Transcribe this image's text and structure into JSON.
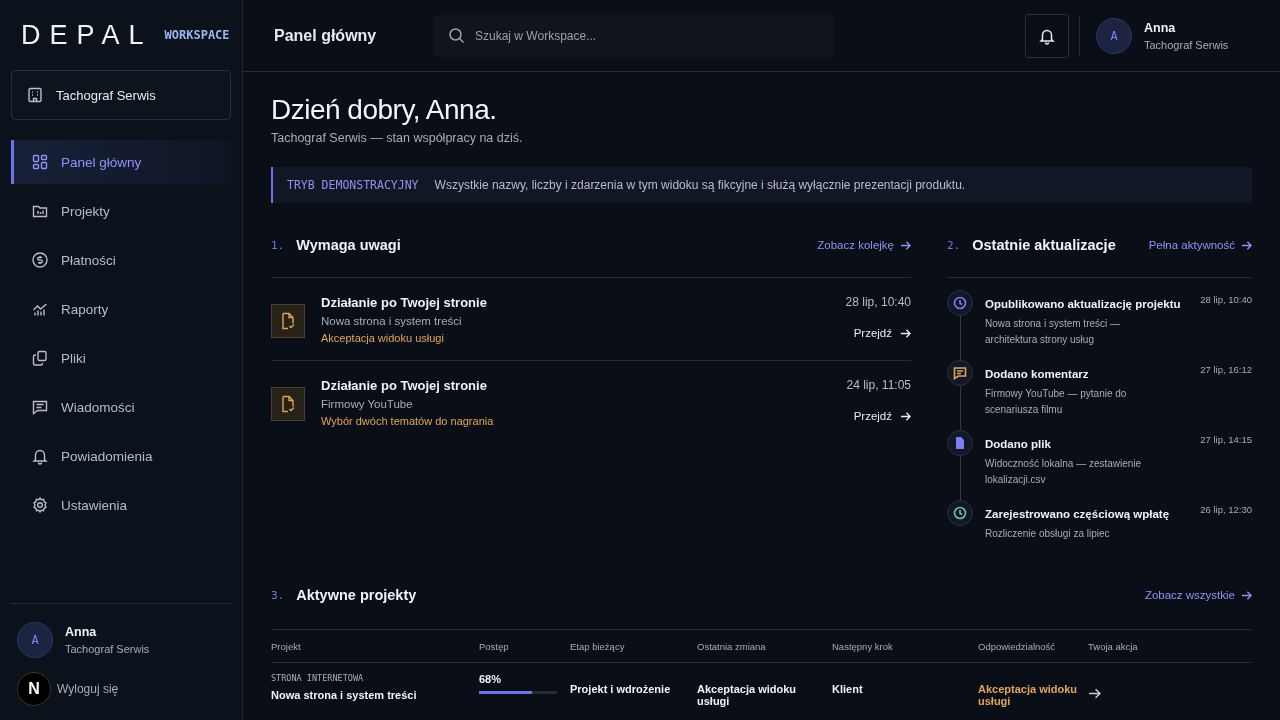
{
  "brand": {
    "logo": "DEPAL",
    "tag": "WORKSPACE"
  },
  "sidebar": {
    "workspace": "Tachograf Serwis",
    "items": [
      {
        "label": "Panel główny",
        "kind": "grid",
        "selected": true
      },
      {
        "label": "Projekty",
        "kind": "folder",
        "selected": false
      },
      {
        "label": "Płatności",
        "kind": "dollar",
        "selected": false
      },
      {
        "label": "Raporty",
        "kind": "chart",
        "selected": false
      },
      {
        "label": "Pliki",
        "kind": "files",
        "selected": false
      },
      {
        "label": "Wiadomości",
        "kind": "message",
        "selected": false
      },
      {
        "label": "Powiadomienia",
        "kind": "bell",
        "selected": false
      },
      {
        "label": "Ustawienia",
        "kind": "gear",
        "selected": false
      }
    ],
    "user": {
      "initial": "A",
      "name": "Anna",
      "company": "Tachograf Serwis"
    },
    "dev_badge": "N",
    "logout": "Wyloguj się"
  },
  "header": {
    "title": "Panel główny",
    "search_placeholder": "Szukaj w Workspace...",
    "user": {
      "initial": "A",
      "name": "Anna",
      "company": "Tachograf Serwis"
    }
  },
  "greeting": {
    "title": "Dzień dobry, Anna.",
    "subtitle": "Tachograf Serwis — stan współpracy na dziś."
  },
  "demo_banner": {
    "label": "TRYB DEMONSTRACYJNY",
    "text": "Wszystkie nazwy, liczby i zdarzenia w tym widoku są fikcyjne i służą wyłącznie prezentacji produktu."
  },
  "attention": {
    "number": "1.",
    "title": "Wymaga uwagi",
    "link": "Zobacz kolejkę",
    "items": [
      {
        "title": "Działanie po Twojej stronie",
        "project": "Nowa strona i system treści",
        "task": "Akceptacja widoku usługi",
        "time": "28 lip, 10:40",
        "action": "Przejdź"
      },
      {
        "title": "Działanie po Twojej stronie",
        "project": "Firmowy YouTube",
        "task": "Wybór dwóch tematów do nagrania",
        "time": "24 lip, 11:05",
        "action": "Przejdź"
      }
    ]
  },
  "updates": {
    "number": "2.",
    "title": "Ostatnie aktualizacje",
    "link": "Pełna aktywność",
    "items": [
      {
        "kind": "clock",
        "color": "#7b7ff0",
        "title": "Opublikowano aktualizację projektu",
        "text": "Nowa strona i system treści — architektura strony usług",
        "time": "28 lip, 10:40"
      },
      {
        "kind": "comment",
        "color": "#e0a55a",
        "title": "Dodano komentarz",
        "text": "Firmowy YouTube — pytanie do scenariusza filmu",
        "time": "27 lip, 16:12"
      },
      {
        "kind": "file",
        "color": "#7b7ff0",
        "title": "Dodano plik",
        "text": "Widoczność lokalna — zestawienie lokalizacji.csv",
        "time": "27 lip, 14:15"
      },
      {
        "kind": "clock",
        "color": "#6fc3a0",
        "title": "Zarejestrowano częściową wpłatę",
        "text": "Rozliczenie obsługi za lipiec",
        "time": "26 lip, 12:30"
      }
    ]
  },
  "projects": {
    "number": "3.",
    "title": "Aktywne projekty",
    "link": "Zobacz wszystkie",
    "columns": [
      "Projekt",
      "Postęp",
      "Etap bieżący",
      "Ostatnia zmiana",
      "Następny krok",
      "Odpowiedzialność",
      "Twoja akcja"
    ],
    "rows": [
      {
        "type": "STRONA INTERNETOWA",
        "name": "Nowa strona i system treści",
        "progress": "68%",
        "level": 0.68,
        "stage": "Projekt i wdrożenie",
        "last_change": "Akceptacja widoku usługi",
        "next_step": "Klient",
        "responsibility": "Akceptacja widoku usługi"
      }
    ]
  }
}
